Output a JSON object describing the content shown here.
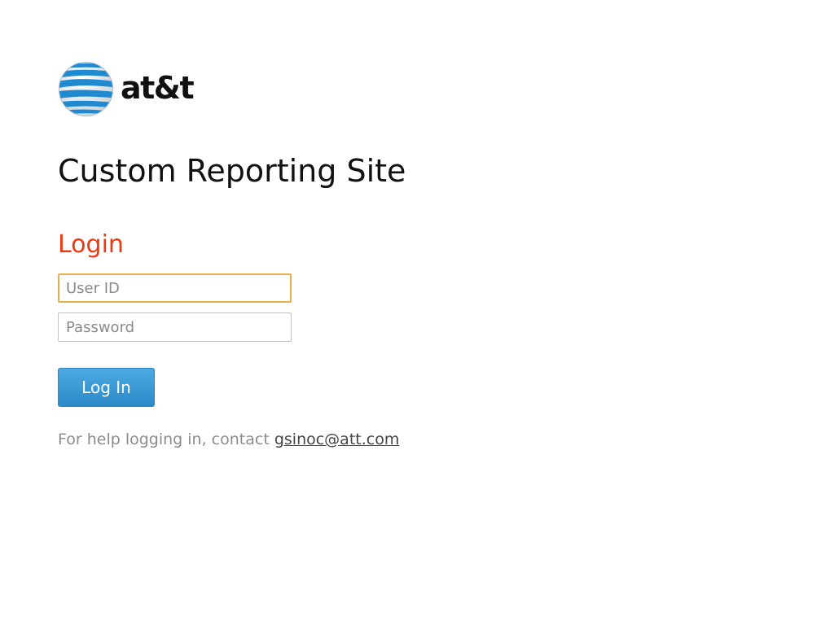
{
  "brand": {
    "logo_text": "at&t",
    "logo_icon": "globe-icon",
    "colors": {
      "globe_blue": "#1f8ad0",
      "globe_light": "#dfe6ec"
    }
  },
  "header": {
    "title": "Custom Reporting Site"
  },
  "login": {
    "heading": "Login",
    "heading_color": "#ea3a12",
    "user_id": {
      "value": "",
      "placeholder": "User ID",
      "focused": true
    },
    "password": {
      "value": "",
      "placeholder": "Password"
    },
    "submit_label": "Log In",
    "button_color": "#2b8ac8"
  },
  "help": {
    "text": "For help logging in, contact ",
    "email": "gsinoc@att.com"
  }
}
